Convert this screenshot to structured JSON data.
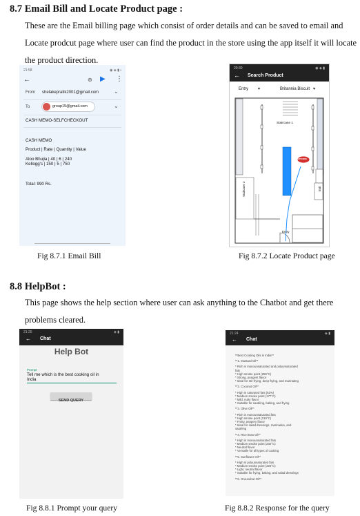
{
  "s87": {
    "heading": "8.7 Email Bill and Locate Product page :",
    "para_line1": "These are the Email billing page which consist of order details and can be saved to email  and",
    "para_line2": "Locate prodcut page where user can find the product in the store using the app itself it will locate",
    "para_line3": "the product direction.",
    "fig1_caption": "Fig 8.7.1 Email Bill",
    "fig2_caption": "Fig 8.7.2 Locate Product page"
  },
  "email": {
    "status_time": "21:58",
    "from_label": "From",
    "from_value": "shelakepratik2001@gmail.com",
    "to_label": "To",
    "to_value": "group15@gmail.com",
    "subject": "CASH MEMO-SELFCHECKOUT",
    "body_title": "CASH MEMO",
    "body_header": "Product | Rate | Quantity | Value",
    "body_line1": "Aloo Bhujia | 40 | 6 | 240",
    "body_line2": "Kellogg's | 150 | 5 | 750",
    "body_total": "Total: 990 Rs."
  },
  "locate": {
    "status_time": "20:30",
    "title": "Search Product",
    "dropdown_left": "Entry",
    "dropdown_right": "Britannia Biscuit",
    "staircase1": "Staircase 1",
    "staircase2": "Staircase 2",
    "exit_label": "Exit",
    "entry_label": "Entry",
    "product_badge": "BRITANNIA"
  },
  "s88": {
    "heading": "8.8 HelpBot :",
    "para_line1": "This page shows the help section where user can ask anything to the Chatbot and get there",
    "para_line2": "problems cleared.",
    "fig1_caption": "Fig 8.8.1 Prompt your query",
    "fig2_caption": "Fig 8.8.2 Response for the query"
  },
  "prompt": {
    "status_time": "21:25",
    "bar_title": "Chat",
    "page_title": "Help Bot",
    "prompt_label": "Prompt",
    "prompt_value_line1": "Tell me which is the best cooking oil in",
    "prompt_value_line2": "India",
    "send_label": "SEND QUERY"
  },
  "response": {
    "status_time": "21:24",
    "bar_title": "Chat",
    "lines": [
      "**Best Cooking Oils in India**",
      "",
      "**1. Mustard Oil**",
      "",
      "* Rich in monounsaturated and polyunsaturated",
      "fats",
      "* High smoke point (250°C)",
      "* Strong, pungent flavor",
      "* Ideal for stir-frying, deep-frying, and marinating",
      "",
      "**2. Coconut Oil**",
      "",
      "* High in saturated fats (62%)",
      "* Medium smoke point (177°C)",
      "* Mild, nutty flavor",
      "* Suitable for sautéing, baking, and frying",
      "",
      "**3. Olive Oil**",
      "",
      "* Rich in monounsaturated fats",
      "* High smoke point (210°C)",
      "* Fruity, peppery flavor",
      "* Ideal for salad dressings, marinades, and",
      "sautéing",
      "",
      "**4. Rice Bran Oil**",
      "",
      "* High in monounsaturated fats",
      "* Medium smoke point (232°C)",
      "* Neutral flavor",
      "* Versatile for all types of cooking",
      "",
      "**5. Sunflower Oil**",
      "",
      "* High in polyunsaturated fats",
      "* Medium smoke point (225°C)",
      "* Light, neutral flavor",
      "* Suitable for frying, baking, and salad dressings",
      "",
      "**6. Groundnut Oil**"
    ]
  }
}
